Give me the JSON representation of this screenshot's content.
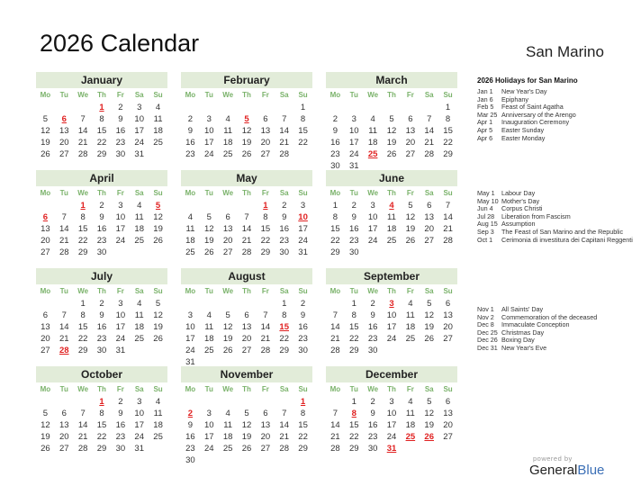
{
  "title": "2026 Calendar",
  "country": "San Marino",
  "weekdays": [
    "Mo",
    "Tu",
    "We",
    "Th",
    "Fr",
    "Sa",
    "Su"
  ],
  "colors": {
    "header_bg": "#e2ecd9",
    "weekday": "#7ab26a",
    "holiday": "#e02020",
    "brand_blue": "#3b6fb6"
  },
  "months": [
    {
      "name": "January",
      "offset": 3,
      "days": 31,
      "holidays": [
        1,
        6
      ]
    },
    {
      "name": "February",
      "offset": 6,
      "days": 28,
      "holidays": [
        5
      ]
    },
    {
      "name": "March",
      "offset": 6,
      "days": 31,
      "holidays": [
        25
      ]
    },
    {
      "name": "April",
      "offset": 2,
      "days": 30,
      "holidays": [
        1,
        5,
        6
      ]
    },
    {
      "name": "May",
      "offset": 4,
      "days": 31,
      "holidays": [
        1,
        10
      ]
    },
    {
      "name": "June",
      "offset": 0,
      "days": 30,
      "holidays": [
        4
      ]
    },
    {
      "name": "July",
      "offset": 2,
      "days": 31,
      "holidays": [
        28
      ]
    },
    {
      "name": "August",
      "offset": 5,
      "days": 31,
      "holidays": [
        15
      ]
    },
    {
      "name": "September",
      "offset": 1,
      "days": 30,
      "holidays": [
        3
      ]
    },
    {
      "name": "October",
      "offset": 3,
      "days": 31,
      "holidays": [
        1
      ]
    },
    {
      "name": "November",
      "offset": 6,
      "days": 30,
      "holidays": [
        1,
        2
      ]
    },
    {
      "name": "December",
      "offset": 1,
      "days": 31,
      "holidays": [
        8,
        25,
        26,
        31
      ]
    }
  ],
  "holidays_title": "2026 Holidays for San Marino",
  "holiday_groups": [
    [
      {
        "date": "Jan 1",
        "name": "New Year's Day"
      },
      {
        "date": "Jan 6",
        "name": "Epiphany"
      },
      {
        "date": "Feb 5",
        "name": "Feast of Saint Agatha"
      },
      {
        "date": "Mar 25",
        "name": "Anniversary of the Arengo"
      },
      {
        "date": "Apr 1",
        "name": "Inauguration Ceremony"
      },
      {
        "date": "Apr 5",
        "name": "Easter Sunday"
      },
      {
        "date": "Apr 6",
        "name": "Easter Monday"
      }
    ],
    [
      {
        "date": "May 1",
        "name": "Labour Day"
      },
      {
        "date": "May 10",
        "name": "Mother's Day"
      },
      {
        "date": "Jun 4",
        "name": "Corpus Christi"
      },
      {
        "date": "Jul 28",
        "name": "Liberation from Fascism"
      },
      {
        "date": "Aug 15",
        "name": "Assumption"
      },
      {
        "date": "Sep 3",
        "name": "The Feast of San Marino and the Republic"
      },
      {
        "date": "Oct 1",
        "name": "Cerimonia di investitura dei Capitani Reggenti"
      }
    ],
    [
      {
        "date": "Nov 1",
        "name": "All Saints' Day"
      },
      {
        "date": "Nov 2",
        "name": "Commemoration of the deceased"
      },
      {
        "date": "Dec 8",
        "name": "Immaculate Conception"
      },
      {
        "date": "Dec 25",
        "name": "Christmas Day"
      },
      {
        "date": "Dec 26",
        "name": "Boxing Day"
      },
      {
        "date": "Dec 31",
        "name": "New Year's Eve"
      }
    ]
  ],
  "footer": {
    "powered": "powered by",
    "brand_a": "General",
    "brand_b": "Blue"
  }
}
